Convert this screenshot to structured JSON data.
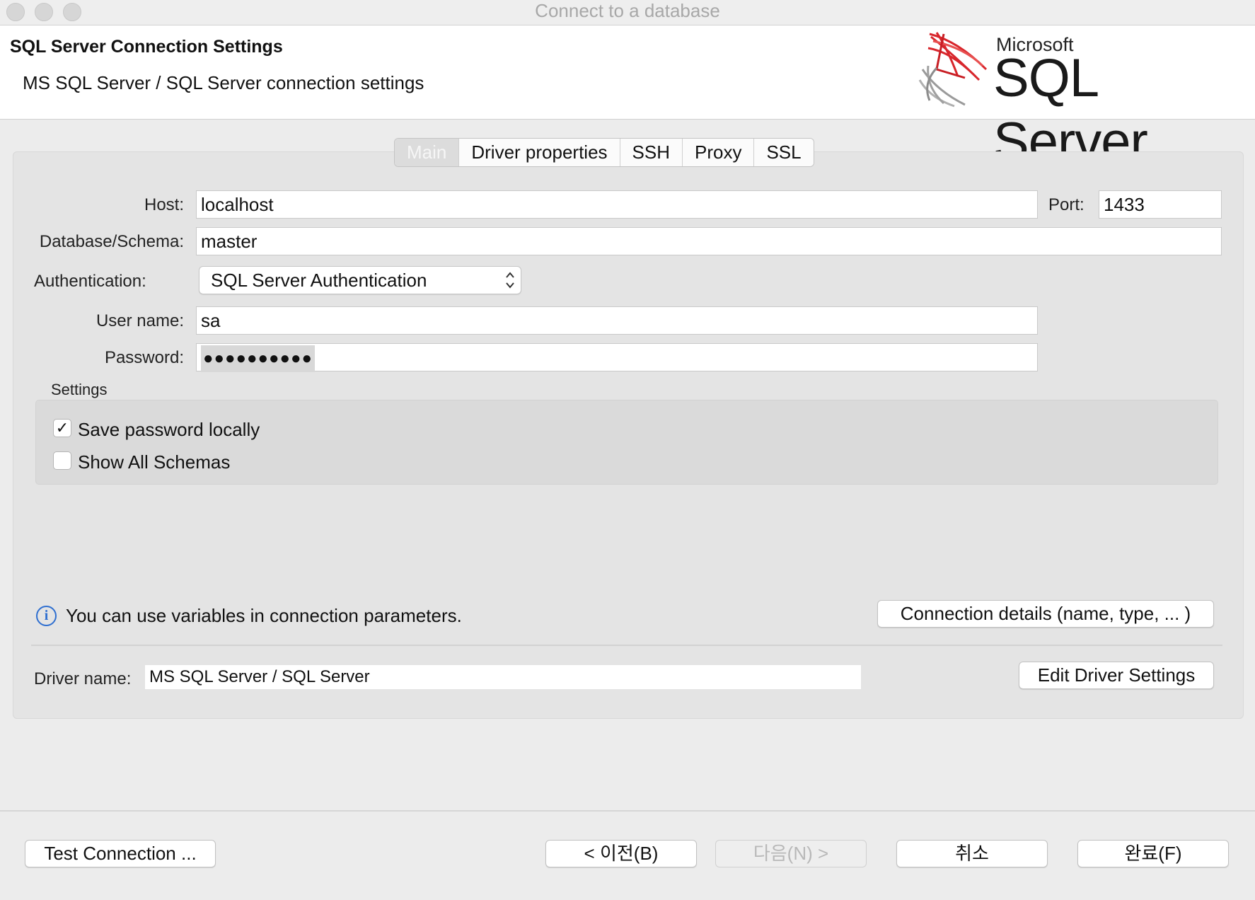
{
  "window": {
    "title": "Connect to a database"
  },
  "header": {
    "title": "SQL Server Connection Settings",
    "subtitle": "MS SQL Server / SQL Server connection settings",
    "logo": {
      "microsoft": "Microsoft",
      "product": "SQL Server"
    }
  },
  "tabs": [
    {
      "label": "Main",
      "active": true
    },
    {
      "label": "Driver properties",
      "active": false
    },
    {
      "label": "SSH",
      "active": false
    },
    {
      "label": "Proxy",
      "active": false
    },
    {
      "label": "SSL",
      "active": false
    }
  ],
  "form": {
    "host_label": "Host:",
    "host_value": "localhost",
    "port_label": "Port:",
    "port_value": "1433",
    "database_label": "Database/Schema:",
    "database_value": "master",
    "auth_label": "Authentication:",
    "auth_value": "SQL Server Authentication",
    "username_label": "User name:",
    "username_value": "sa",
    "password_label": "Password:",
    "password_masked": "●●●●●●●●●●"
  },
  "settings": {
    "title": "Settings",
    "save_password": {
      "label": "Save password locally",
      "checked": true,
      "mark": "✓"
    },
    "show_all_schemas": {
      "label": "Show All Schemas",
      "checked": false
    }
  },
  "info": {
    "icon": "i",
    "text": "You can use variables in connection parameters."
  },
  "buttons": {
    "connection_details": "Connection details (name, type, ... )",
    "edit_driver_settings": "Edit Driver Settings",
    "test_connection": "Test Connection ...",
    "back": "< 이전(B)",
    "next": "다음(N) >",
    "cancel": "취소",
    "finish": "완료(F)"
  },
  "driver": {
    "label": "Driver name:",
    "value": "MS SQL Server / SQL Server"
  },
  "colors": {
    "info_blue": "#2f6fd0",
    "logo_red": "#d8262c",
    "panel_bg": "#e4e4e4"
  }
}
